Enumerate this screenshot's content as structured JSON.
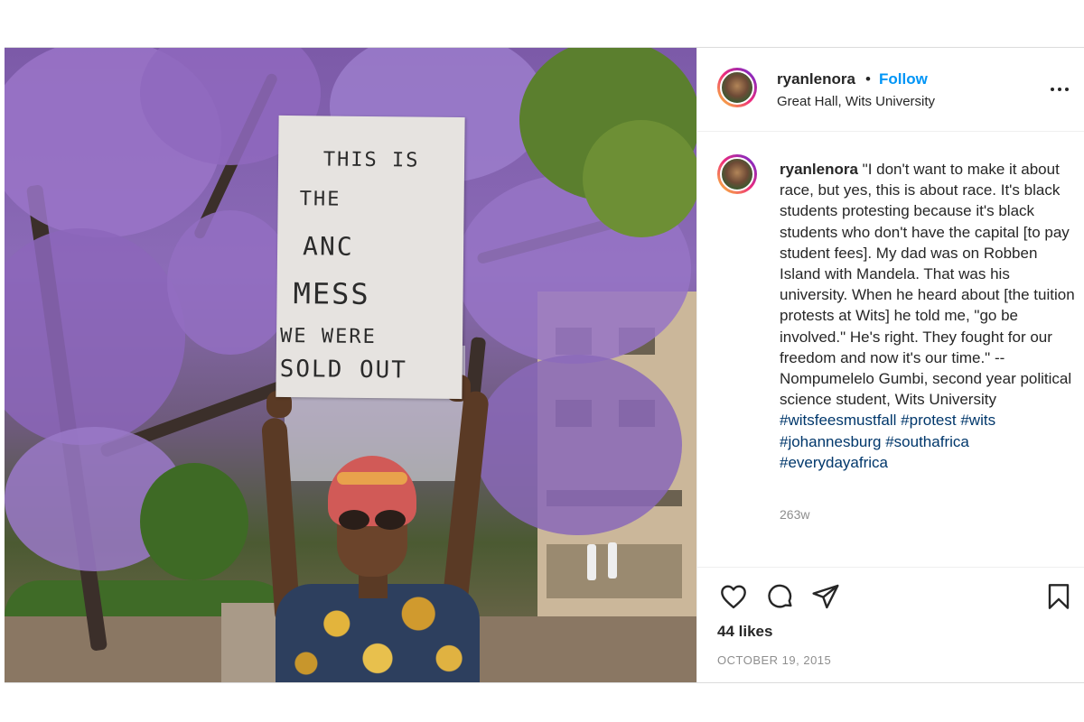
{
  "post": {
    "username": "ryanlenora",
    "separator": "•",
    "follow_label": "Follow",
    "location": "Great Hall, Wits University",
    "photo_sign_lines": [
      "THIS  IS",
      "THE",
      "ANC",
      "MESS",
      "WE WERE",
      "SOLD OUT"
    ],
    "caption": {
      "username": "ryanlenora",
      "text": "\"I don't want to make it about race, but yes, this is about race. It's black students protesting because it's black students who don't have the capital [to pay student fees]. My dad was on Robben Island with Mandela. That was his university. When he heard about [the tuition protests at Wits] he told me, \"go be involved.\" He's right. They fought for our freedom and now it's our time.\" -- Nompumelelo Gumbi, second year political science student, Wits University",
      "hashtags": [
        "#witsfeesmustfall",
        "#protest",
        "#wits",
        "#johannesburg",
        "#southafrica",
        "#everydayafrica"
      ]
    },
    "age": "263w",
    "likes": "44 likes",
    "date": "OCTOBER 19, 2015"
  },
  "icons": {
    "more": "more-options-icon",
    "like": "heart-icon",
    "comment": "comment-icon",
    "share": "paper-plane-icon",
    "save": "bookmark-icon"
  },
  "colors": {
    "link_blue": "#0095f6",
    "hashtag": "#00376b",
    "muted": "#8e8e8e",
    "text": "#262626"
  }
}
